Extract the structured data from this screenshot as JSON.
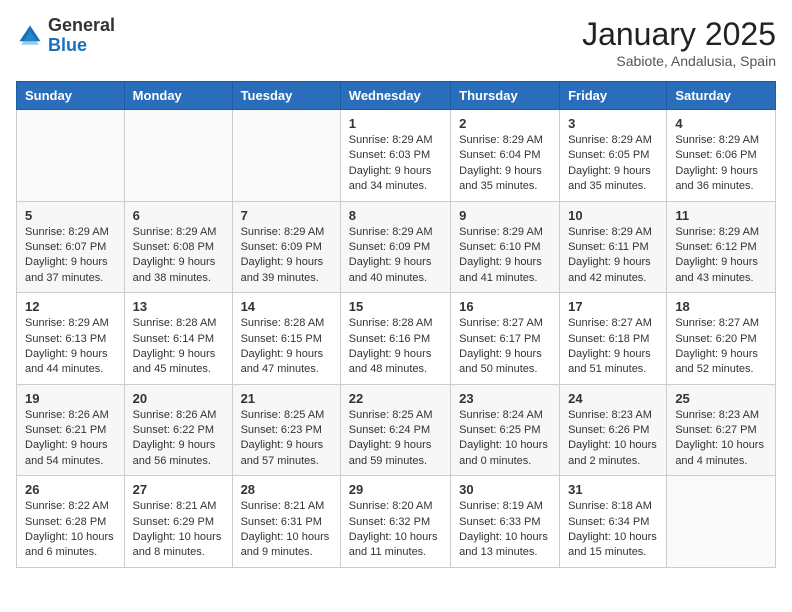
{
  "header": {
    "logo_general": "General",
    "logo_blue": "Blue",
    "month": "January 2025",
    "location": "Sabiote, Andalusia, Spain"
  },
  "weekdays": [
    "Sunday",
    "Monday",
    "Tuesday",
    "Wednesday",
    "Thursday",
    "Friday",
    "Saturday"
  ],
  "weeks": [
    [
      {
        "day": "",
        "content": ""
      },
      {
        "day": "",
        "content": ""
      },
      {
        "day": "",
        "content": ""
      },
      {
        "day": "1",
        "content": "Sunrise: 8:29 AM\nSunset: 6:03 PM\nDaylight: 9 hours\nand 34 minutes."
      },
      {
        "day": "2",
        "content": "Sunrise: 8:29 AM\nSunset: 6:04 PM\nDaylight: 9 hours\nand 35 minutes."
      },
      {
        "day": "3",
        "content": "Sunrise: 8:29 AM\nSunset: 6:05 PM\nDaylight: 9 hours\nand 35 minutes."
      },
      {
        "day": "4",
        "content": "Sunrise: 8:29 AM\nSunset: 6:06 PM\nDaylight: 9 hours\nand 36 minutes."
      }
    ],
    [
      {
        "day": "5",
        "content": "Sunrise: 8:29 AM\nSunset: 6:07 PM\nDaylight: 9 hours\nand 37 minutes."
      },
      {
        "day": "6",
        "content": "Sunrise: 8:29 AM\nSunset: 6:08 PM\nDaylight: 9 hours\nand 38 minutes."
      },
      {
        "day": "7",
        "content": "Sunrise: 8:29 AM\nSunset: 6:09 PM\nDaylight: 9 hours\nand 39 minutes."
      },
      {
        "day": "8",
        "content": "Sunrise: 8:29 AM\nSunset: 6:09 PM\nDaylight: 9 hours\nand 40 minutes."
      },
      {
        "day": "9",
        "content": "Sunrise: 8:29 AM\nSunset: 6:10 PM\nDaylight: 9 hours\nand 41 minutes."
      },
      {
        "day": "10",
        "content": "Sunrise: 8:29 AM\nSunset: 6:11 PM\nDaylight: 9 hours\nand 42 minutes."
      },
      {
        "day": "11",
        "content": "Sunrise: 8:29 AM\nSunset: 6:12 PM\nDaylight: 9 hours\nand 43 minutes."
      }
    ],
    [
      {
        "day": "12",
        "content": "Sunrise: 8:29 AM\nSunset: 6:13 PM\nDaylight: 9 hours\nand 44 minutes."
      },
      {
        "day": "13",
        "content": "Sunrise: 8:28 AM\nSunset: 6:14 PM\nDaylight: 9 hours\nand 45 minutes."
      },
      {
        "day": "14",
        "content": "Sunrise: 8:28 AM\nSunset: 6:15 PM\nDaylight: 9 hours\nand 47 minutes."
      },
      {
        "day": "15",
        "content": "Sunrise: 8:28 AM\nSunset: 6:16 PM\nDaylight: 9 hours\nand 48 minutes."
      },
      {
        "day": "16",
        "content": "Sunrise: 8:27 AM\nSunset: 6:17 PM\nDaylight: 9 hours\nand 50 minutes."
      },
      {
        "day": "17",
        "content": "Sunrise: 8:27 AM\nSunset: 6:18 PM\nDaylight: 9 hours\nand 51 minutes."
      },
      {
        "day": "18",
        "content": "Sunrise: 8:27 AM\nSunset: 6:20 PM\nDaylight: 9 hours\nand 52 minutes."
      }
    ],
    [
      {
        "day": "19",
        "content": "Sunrise: 8:26 AM\nSunset: 6:21 PM\nDaylight: 9 hours\nand 54 minutes."
      },
      {
        "day": "20",
        "content": "Sunrise: 8:26 AM\nSunset: 6:22 PM\nDaylight: 9 hours\nand 56 minutes."
      },
      {
        "day": "21",
        "content": "Sunrise: 8:25 AM\nSunset: 6:23 PM\nDaylight: 9 hours\nand 57 minutes."
      },
      {
        "day": "22",
        "content": "Sunrise: 8:25 AM\nSunset: 6:24 PM\nDaylight: 9 hours\nand 59 minutes."
      },
      {
        "day": "23",
        "content": "Sunrise: 8:24 AM\nSunset: 6:25 PM\nDaylight: 10 hours\nand 0 minutes."
      },
      {
        "day": "24",
        "content": "Sunrise: 8:23 AM\nSunset: 6:26 PM\nDaylight: 10 hours\nand 2 minutes."
      },
      {
        "day": "25",
        "content": "Sunrise: 8:23 AM\nSunset: 6:27 PM\nDaylight: 10 hours\nand 4 minutes."
      }
    ],
    [
      {
        "day": "26",
        "content": "Sunrise: 8:22 AM\nSunset: 6:28 PM\nDaylight: 10 hours\nand 6 minutes."
      },
      {
        "day": "27",
        "content": "Sunrise: 8:21 AM\nSunset: 6:29 PM\nDaylight: 10 hours\nand 8 minutes."
      },
      {
        "day": "28",
        "content": "Sunrise: 8:21 AM\nSunset: 6:31 PM\nDaylight: 10 hours\nand 9 minutes."
      },
      {
        "day": "29",
        "content": "Sunrise: 8:20 AM\nSunset: 6:32 PM\nDaylight: 10 hours\nand 11 minutes."
      },
      {
        "day": "30",
        "content": "Sunrise: 8:19 AM\nSunset: 6:33 PM\nDaylight: 10 hours\nand 13 minutes."
      },
      {
        "day": "31",
        "content": "Sunrise: 8:18 AM\nSunset: 6:34 PM\nDaylight: 10 hours\nand 15 minutes."
      },
      {
        "day": "",
        "content": ""
      }
    ]
  ]
}
